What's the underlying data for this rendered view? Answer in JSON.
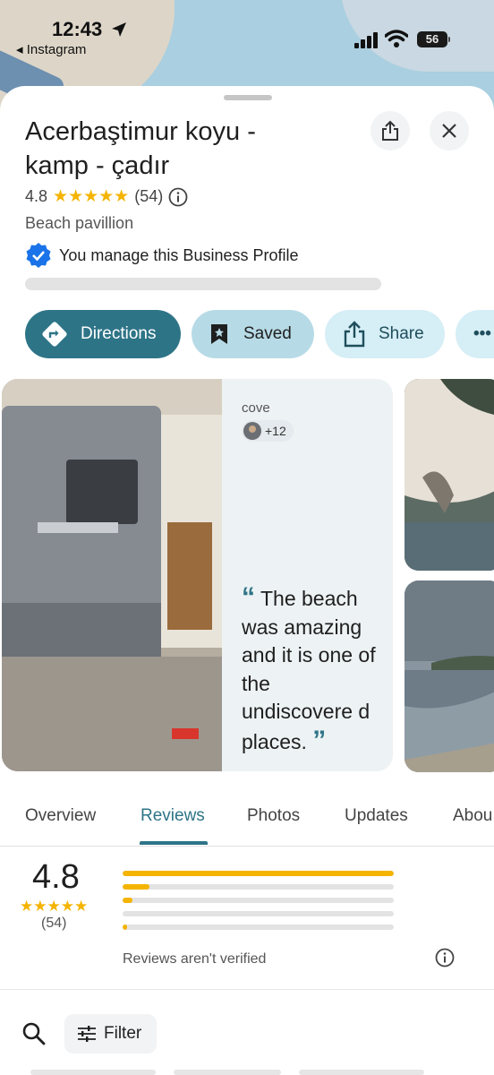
{
  "status_bar": {
    "time": "12:43",
    "back_app": "Instagram",
    "battery": "56"
  },
  "place": {
    "title": "Acerbaştimur koyu - kamp - çadır",
    "rating": "4.8",
    "stars": "★★★★★",
    "review_count": "(54)",
    "category": "Beach pavillion",
    "manage_text": "You manage this Business Profile"
  },
  "actions": {
    "directions": "Directions",
    "saved": "Saved",
    "share": "Share",
    "more": "•••"
  },
  "review_highlight": {
    "author": "cove",
    "others": "+12",
    "quote": "The beach was amazing and it is one of the undiscovere d places.",
    "open_quote": "“",
    "close_quote": "”"
  },
  "tabs": [
    "Overview",
    "Reviews",
    "Photos",
    "Updates",
    "Abou"
  ],
  "active_tab": "Reviews",
  "reviews_summary": {
    "rating": "4.8",
    "stars": "★★★★★",
    "count": "(54)",
    "distribution": [
      1.0,
      0.1,
      0.035,
      0.0,
      0.015
    ],
    "note": "Reviews aren't verified"
  },
  "filter": {
    "label": "Filter"
  },
  "colors": {
    "accent": "#2e7487",
    "star": "#f4b400",
    "verified": "#1a73e8"
  }
}
